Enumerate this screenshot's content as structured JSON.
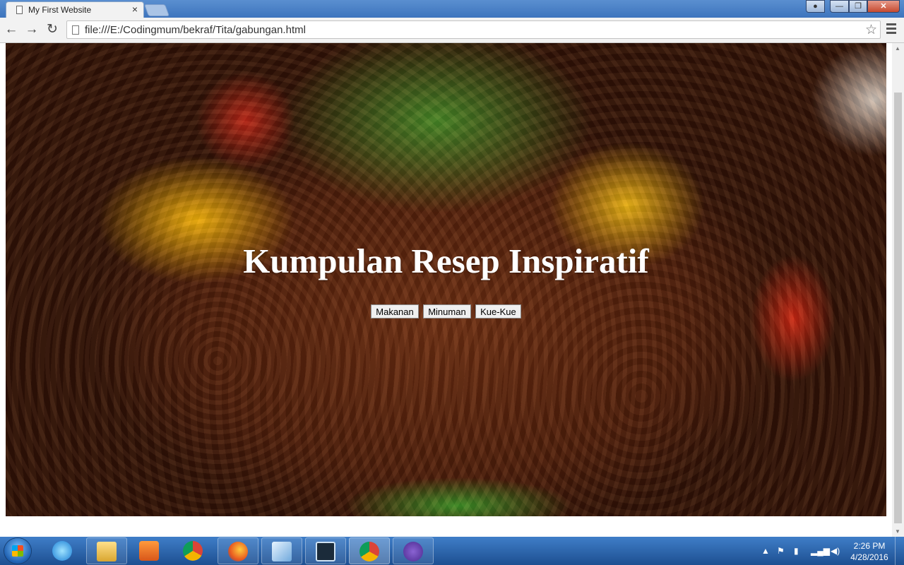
{
  "browser": {
    "tab_title": "My First Website",
    "tab_close": "×",
    "url": "file:///E:/Codingmum/bekraf/Tita/gabungan.html",
    "back_icon": "←",
    "forward_icon": "→",
    "reload_icon": "↻",
    "star_icon": "☆"
  },
  "window_controls": {
    "minimize": "—",
    "maximize": "❐",
    "close": "✕",
    "user": "👤"
  },
  "page": {
    "title": "Kumpulan Resep Inspiratif",
    "nav": [
      "Makanan",
      "Minuman",
      "Kue-Kue"
    ]
  },
  "taskbar": {
    "time": "2:26 PM",
    "date": "4/28/2016",
    "apps": [
      "ie",
      "file-explorer",
      "media-player",
      "chrome",
      "firefox",
      "notepad",
      "brackets",
      "chrome-active",
      "github"
    ]
  },
  "colors": {
    "taskbar": "#2a63a8",
    "close_button": "#c64a2f",
    "hero_title": "#ffffff"
  }
}
